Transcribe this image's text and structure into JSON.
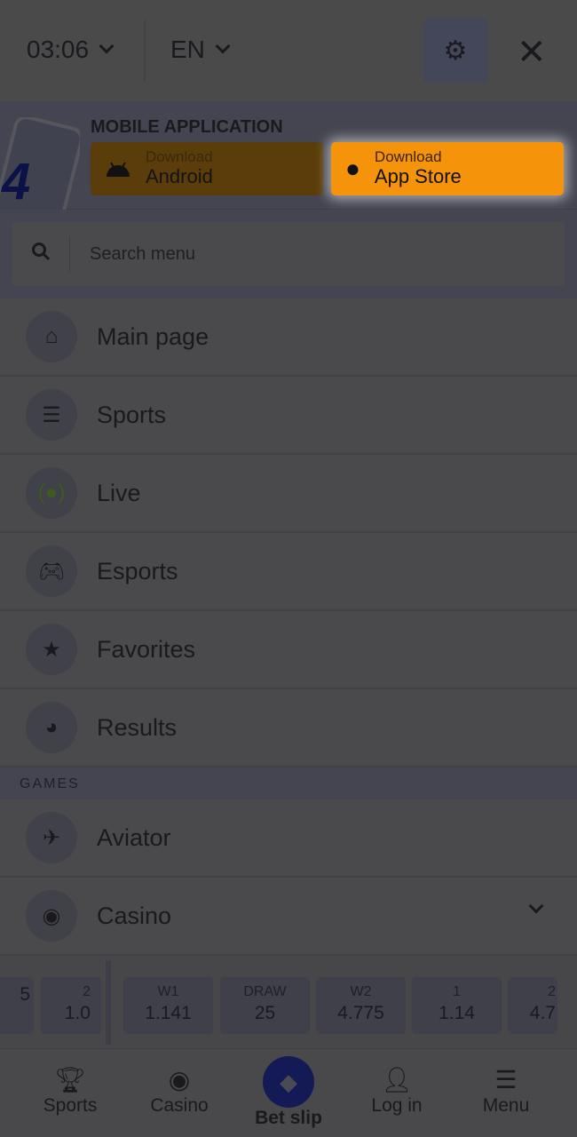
{
  "header": {
    "time": "03:06",
    "language": "EN",
    "settings_icon": "gear-icon",
    "close_icon": "close-icon"
  },
  "app": {
    "title": "MOBILE APPLICATION",
    "android": {
      "small": "Download",
      "large": "Android"
    },
    "ios": {
      "small": "Download",
      "large": "App Store"
    },
    "accent": "#f5940a"
  },
  "search": {
    "placeholder": "Search menu"
  },
  "menu": [
    {
      "label": "Main page",
      "icon": "home-icon"
    },
    {
      "label": "Sports",
      "icon": "list-icon"
    },
    {
      "label": "Live",
      "icon": "live-icon"
    },
    {
      "label": "Esports",
      "icon": "gamepad-icon"
    },
    {
      "label": "Favorites",
      "icon": "star-icon"
    },
    {
      "label": "Results",
      "icon": "pie-chart-icon"
    }
  ],
  "games_header": "GAMES",
  "games": [
    {
      "label": "Aviator",
      "icon": "plane-icon"
    },
    {
      "label": "Casino",
      "icon": "chip-icon"
    }
  ],
  "odds": {
    "left": [
      {
        "k": "",
        "v": "5"
      },
      {
        "k": "2",
        "v": "1.0"
      }
    ],
    "right": [
      {
        "k": "W1",
        "v": "1.141"
      },
      {
        "k": "DRAW",
        "v": "25"
      },
      {
        "k": "W2",
        "v": "4.775"
      },
      {
        "k": "1",
        "v": "1.14"
      },
      {
        "k": "2",
        "v": "4.7"
      }
    ]
  },
  "nav": [
    {
      "label": "Sports"
    },
    {
      "label": "Casino"
    },
    {
      "label": "Bet slip"
    },
    {
      "label": "Log in"
    },
    {
      "label": "Menu"
    }
  ]
}
